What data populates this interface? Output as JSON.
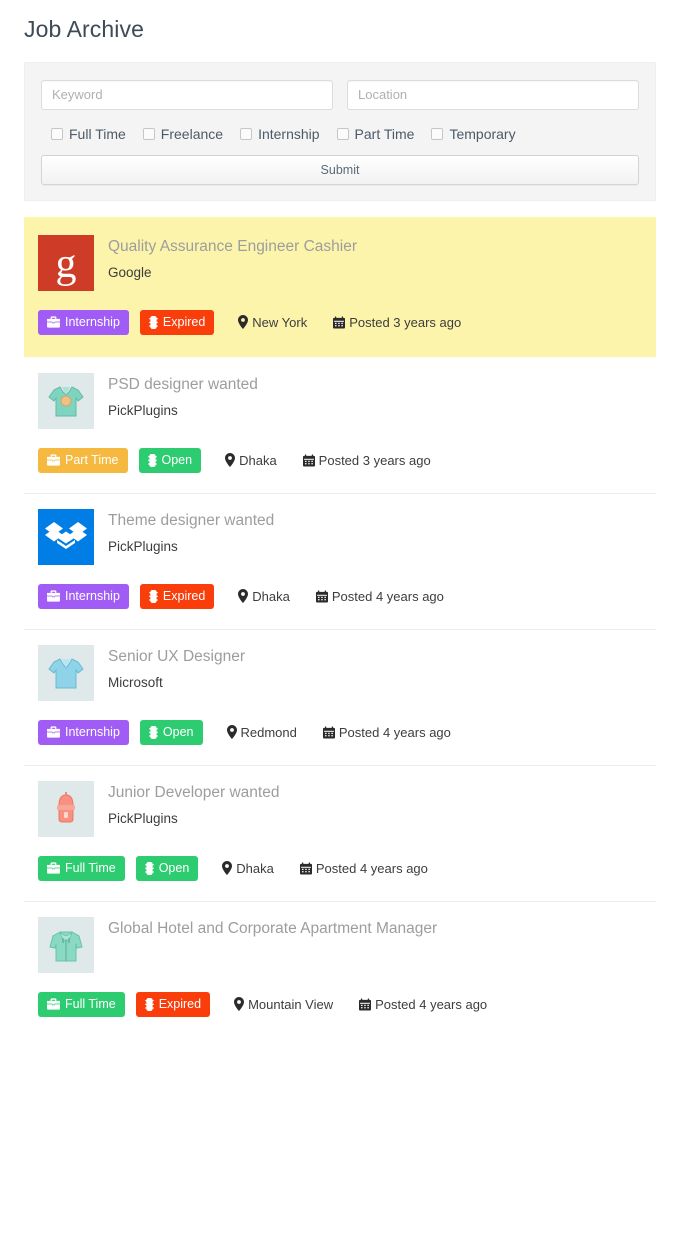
{
  "page": {
    "title": "Job Archive"
  },
  "search": {
    "keyword_placeholder": "Keyword",
    "keyword_value": "",
    "location_placeholder": "Location",
    "location_value": "",
    "submit_label": "Submit",
    "job_type_filters": [
      {
        "label": "Full Time",
        "checked": false
      },
      {
        "label": "Freelance",
        "checked": false
      },
      {
        "label": "Internship",
        "checked": false
      },
      {
        "label": "Part Time",
        "checked": false
      },
      {
        "label": "Temporary",
        "checked": false
      }
    ]
  },
  "icons": {
    "briefcase": "briefcase-icon",
    "traffic_light": "traffic-light-icon",
    "map_marker": "map-marker-icon",
    "calendar": "calendar-icon"
  },
  "colors": {
    "featured_background": "#fcf4ab",
    "badge_internship": "#a05cf5",
    "badge_part_time": "#f6b93f",
    "badge_full_time": "#2ecc71",
    "badge_open": "#2ecc71",
    "badge_expired": "#f93e0c",
    "title_text": "#9d9d9d",
    "company_text": "#3c3c3c",
    "panel_background": "#f4f4f4",
    "google_logo": "#ce3b26",
    "dropbox_logo": "#007ee5"
  },
  "jobs": [
    {
      "title": "Quality Assurance Engineer Cashier",
      "company": "Google",
      "featured": true,
      "logo": "google-logo",
      "job_type": {
        "label": "Internship",
        "color": "#a05cf5"
      },
      "status": {
        "label": "Expired",
        "color": "#f93e0c"
      },
      "location": "New York",
      "posted": "Posted 3 years ago"
    },
    {
      "title": "PSD designer wanted",
      "company": "PickPlugins",
      "featured": false,
      "logo": "green-polo-shirt",
      "job_type": {
        "label": "Part Time",
        "color": "#f6b93f"
      },
      "status": {
        "label": "Open",
        "color": "#2ecc71"
      },
      "location": "Dhaka",
      "posted": "Posted 3 years ago"
    },
    {
      "title": "Theme designer wanted",
      "company": "PickPlugins",
      "featured": false,
      "logo": "dropbox-logo",
      "job_type": {
        "label": "Internship",
        "color": "#a05cf5"
      },
      "status": {
        "label": "Expired",
        "color": "#f93e0c"
      },
      "location": "Dhaka",
      "posted": "Posted 4 years ago"
    },
    {
      "title": "Senior UX Designer",
      "company": "Microsoft",
      "featured": false,
      "logo": "blue-polo-shirt",
      "job_type": {
        "label": "Internship",
        "color": "#a05cf5"
      },
      "status": {
        "label": "Open",
        "color": "#2ecc71"
      },
      "location": "Redmond",
      "posted": "Posted 4 years ago"
    },
    {
      "title": "Junior Developer wanted",
      "company": "PickPlugins",
      "featured": false,
      "logo": "pink-beanie",
      "job_type": {
        "label": "Full Time",
        "color": "#2ecc71"
      },
      "status": {
        "label": "Open",
        "color": "#2ecc71"
      },
      "location": "Dhaka",
      "posted": "Posted 4 years ago"
    },
    {
      "title": "Global Hotel and Corporate Apartment Manager",
      "company": "",
      "featured": false,
      "logo": "green-hoodie",
      "job_type": {
        "label": "Full Time",
        "color": "#2ecc71"
      },
      "status": {
        "label": "Expired",
        "color": "#f93e0c"
      },
      "location": "Mountain View",
      "posted": "Posted 4 years ago"
    }
  ]
}
